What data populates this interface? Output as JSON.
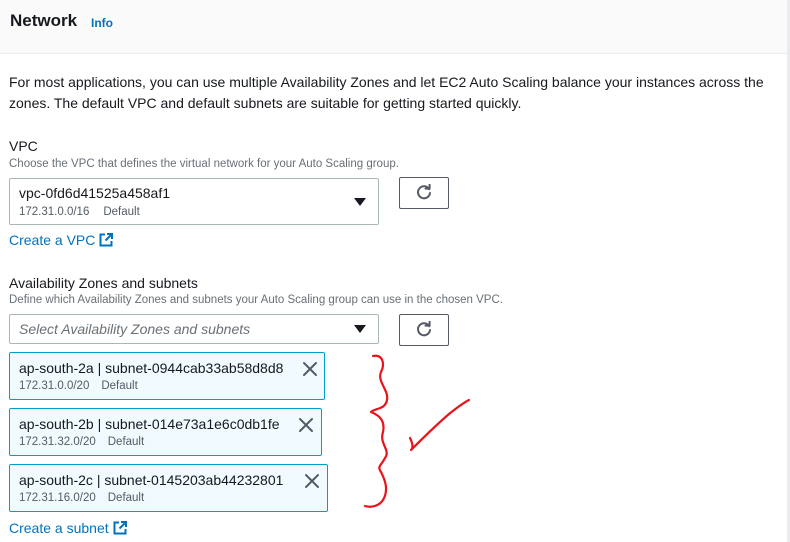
{
  "header": {
    "title": "Network",
    "info_label": "Info"
  },
  "description": "For most applications, you can use multiple Availability Zones and let EC2 Auto Scaling balance your instances across the zones. The default VPC and default subnets are suitable for getting started quickly.",
  "vpc": {
    "label": "VPC",
    "hint": "Choose the VPC that defines the virtual network for your Auto Scaling group.",
    "selected_value": "vpc-0fd6d41525a458af1",
    "selected_cidr": "172.31.0.0/16",
    "selected_tag": "Default",
    "create_link": "Create a VPC"
  },
  "az": {
    "label": "Availability Zones and subnets",
    "hint": "Define which Availability Zones and subnets your Auto Scaling group can use in the chosen VPC.",
    "placeholder": "Select Availability Zones and subnets",
    "tokens": [
      {
        "name": "ap-south-2a | subnet-0944cab33ab58d8d8",
        "cidr": "172.31.0.0/20",
        "tag": "Default"
      },
      {
        "name": "ap-south-2b | subnet-014e73a1e6c0db1fe",
        "cidr": "172.31.32.0/20",
        "tag": "Default"
      },
      {
        "name": "ap-south-2c | subnet-0145203ab44232801",
        "cidr": "172.31.16.0/20",
        "tag": "Default"
      }
    ],
    "create_link": "Create a subnet"
  },
  "colors": {
    "link": "#0073bb",
    "token_border": "#00a1c9",
    "token_bg": "#f1faff",
    "annotation": "#e8141c"
  },
  "icons": [
    "refresh-icon",
    "caret-down-icon",
    "external-link-icon",
    "close-icon"
  ]
}
